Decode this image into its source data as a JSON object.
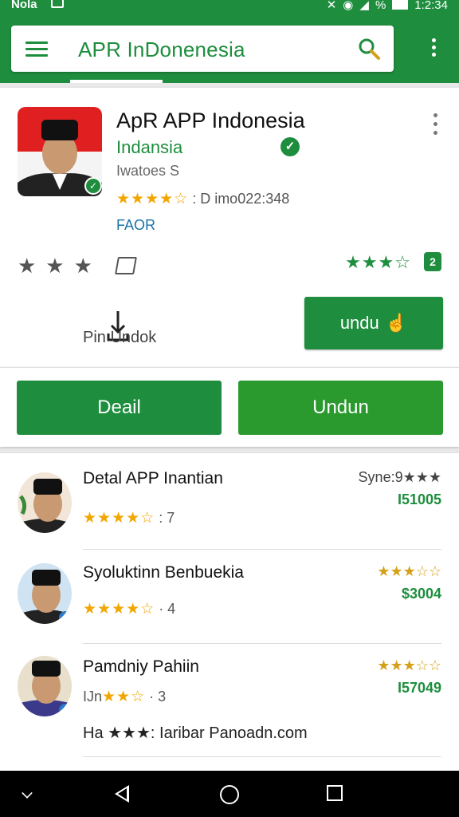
{
  "status_bar": {
    "carrier": "Nola",
    "time": "1:2:34",
    "percent": "%"
  },
  "app_bar": {
    "title": "APR InDonenesia"
  },
  "app": {
    "title": "ApR APP Indonesia",
    "developer": "Indansia",
    "meta": "Iwatoes S",
    "rating_stars": "★★★★☆",
    "rating_text": ": D imo022:348",
    "tag": "FAOR",
    "rate_stars": "★★★",
    "right_stars": "★★★☆",
    "badge": "2",
    "install_secondary_label": "Pin Undok",
    "install_primary_label": "undu"
  },
  "actions": {
    "detail_label": "Deail",
    "undun_label": "Undun"
  },
  "list": [
    {
      "name": "Detal APP Inantian",
      "stars": "★★★★☆",
      "count": ": 7",
      "right_top": "Syne:9★★★",
      "right_price": "I51005"
    },
    {
      "name": "Syoluktinn Benbuekia",
      "stars": "★★★★☆",
      "count": "· 4",
      "right_top": "★★★☆☆",
      "right_price": "$3004"
    },
    {
      "name": "Pamdniy Pahiin",
      "stars": "★★☆",
      "prefix": "IJn",
      "count": "· 3",
      "right_top": "★★★☆☆",
      "right_price": "I57049"
    }
  ],
  "extra_line": "Ha ★★★: Iaribar Panoadn.com",
  "colors": {
    "brand": "#1e8e3e",
    "star": "#f2a600"
  },
  "icons": [
    "menu-icon",
    "search-icon",
    "more-vert-icon",
    "verified-icon",
    "share-icon",
    "download-icon",
    "back-icon",
    "home-icon",
    "recents-icon"
  ]
}
